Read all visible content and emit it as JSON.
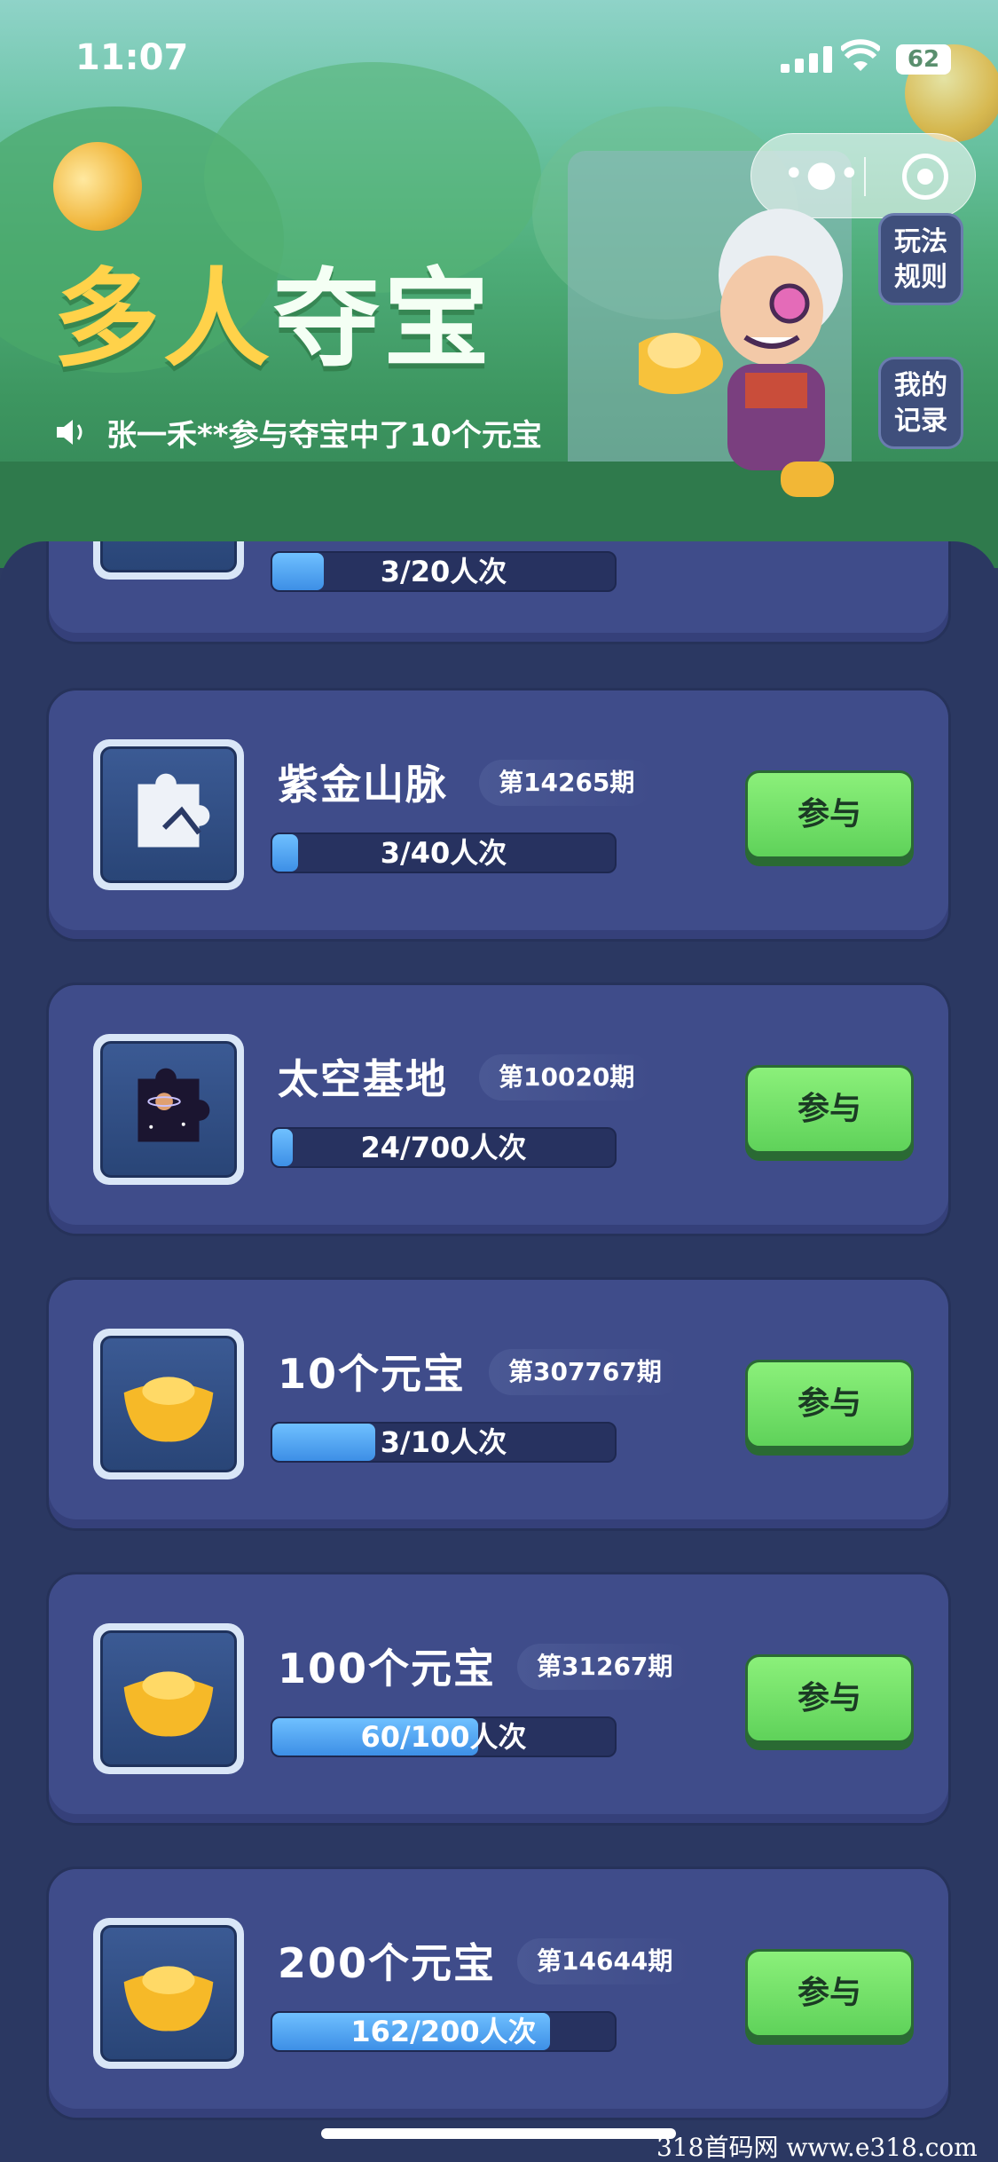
{
  "status_bar": {
    "time": "11:07",
    "battery": "62"
  },
  "header": {
    "title_part1": "多人",
    "title_part2": "夺宝",
    "ticker": "张一禾**参与夺宝中了10个元宝",
    "rules_button": {
      "line1": "玩法",
      "line2": "规则"
    },
    "records_button": {
      "line1": "我的",
      "line2": "记录"
    }
  },
  "cards": [
    {
      "name": "",
      "issue": "",
      "progress_text": "3/20人次",
      "progress": 0.15
    },
    {
      "name": "紫金山脉",
      "issue": "第14265期",
      "progress_text": "3/40人次",
      "progress": 0.075,
      "join": "参与",
      "icon": "puzzle-mountain-icon"
    },
    {
      "name": "太空基地",
      "issue": "第10020期",
      "progress_text": "24/700人次",
      "progress": 0.034,
      "join": "参与",
      "icon": "puzzle-space-icon"
    },
    {
      "name": "10个元宝",
      "issue": "第307767期",
      "progress_text": "3/10人次",
      "progress": 0.3,
      "join": "参与",
      "icon": "gold-ingot-icon"
    },
    {
      "name": "100个元宝",
      "issue": "第31267期",
      "progress_text": "60/100人次",
      "progress": 0.6,
      "join": "参与",
      "icon": "gold-ingot-icon"
    },
    {
      "name": "200个元宝",
      "issue": "第14644期",
      "progress_text": "162/200人次",
      "progress": 0.81,
      "join": "参与",
      "icon": "gold-ingot-icon"
    }
  ],
  "watermark": "318首码网  www.e318.com",
  "colors": {
    "accent_green": "#5fd25a",
    "panel_bg": "#2b3862",
    "card_bg": "#3f4c8a",
    "progress_blue": "#3d8fe6"
  }
}
